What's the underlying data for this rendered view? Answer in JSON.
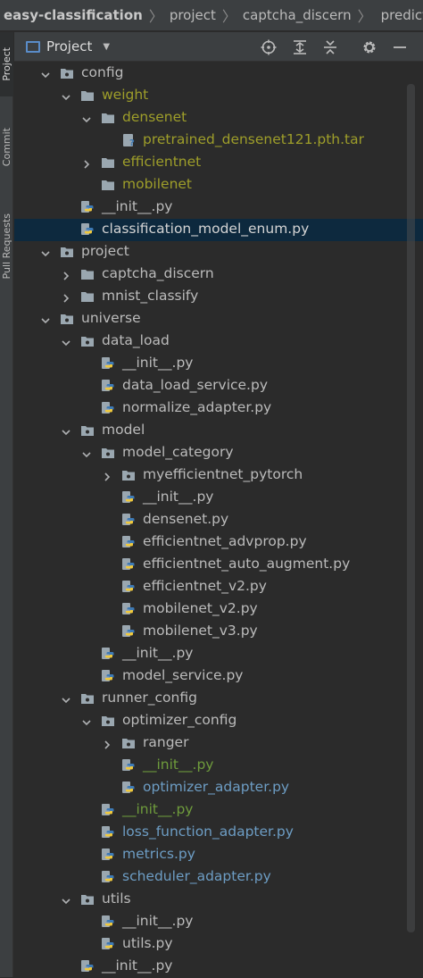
{
  "breadcrumb": {
    "items": [
      "easy-classification",
      "project",
      "captcha_discern",
      "predict.p"
    ]
  },
  "strip": {
    "tabs": [
      "Project",
      "Commit",
      "Pull Requests"
    ]
  },
  "toolbar": {
    "title": "Project"
  },
  "colors": {
    "background": "#2b2b2b",
    "selected_row": "#0d293e",
    "folder": "#9aa7b0",
    "olive_text": "#9e9e2a",
    "green_text": "#6e9b3c",
    "blue_text": "#6d9dc4"
  },
  "tree": [
    {
      "label": "config",
      "depth": 0,
      "kind": "package",
      "chev": "down",
      "color": "normal"
    },
    {
      "label": "weight",
      "depth": 1,
      "kind": "folder",
      "chev": "down",
      "color": "olive"
    },
    {
      "label": "densenet",
      "depth": 2,
      "kind": "folder",
      "chev": "down",
      "color": "olive"
    },
    {
      "label": "pretrained_densenet121.pth.tar",
      "depth": 3,
      "kind": "unknown",
      "chev": "none",
      "color": "olive"
    },
    {
      "label": "efficientnet",
      "depth": 2,
      "kind": "folder",
      "chev": "right",
      "color": "olive"
    },
    {
      "label": "mobilenet",
      "depth": 2,
      "kind": "folder",
      "chev": "none",
      "color": "olive"
    },
    {
      "label": "__init__.py",
      "depth": 1,
      "kind": "python",
      "chev": "none",
      "color": "normal"
    },
    {
      "label": "classification_model_enum.py",
      "depth": 1,
      "kind": "python",
      "chev": "none",
      "color": "white",
      "selected": true
    },
    {
      "label": "project",
      "depth": 0,
      "kind": "package",
      "chev": "down",
      "color": "normal"
    },
    {
      "label": "captcha_discern",
      "depth": 1,
      "kind": "folder",
      "chev": "right",
      "color": "normal"
    },
    {
      "label": "mnist_classify",
      "depth": 1,
      "kind": "folder",
      "chev": "right",
      "color": "normal"
    },
    {
      "label": "universe",
      "depth": 0,
      "kind": "package",
      "chev": "down",
      "color": "normal"
    },
    {
      "label": "data_load",
      "depth": 1,
      "kind": "package",
      "chev": "down",
      "color": "normal"
    },
    {
      "label": "__init__.py",
      "depth": 2,
      "kind": "python",
      "chev": "none",
      "color": "normal"
    },
    {
      "label": "data_load_service.py",
      "depth": 2,
      "kind": "python",
      "chev": "none",
      "color": "normal"
    },
    {
      "label": "normalize_adapter.py",
      "depth": 2,
      "kind": "python",
      "chev": "none",
      "color": "normal"
    },
    {
      "label": "model",
      "depth": 1,
      "kind": "package",
      "chev": "down",
      "color": "normal"
    },
    {
      "label": "model_category",
      "depth": 2,
      "kind": "package",
      "chev": "down",
      "color": "normal"
    },
    {
      "label": "myefficientnet_pytorch",
      "depth": 3,
      "kind": "package",
      "chev": "right",
      "color": "normal"
    },
    {
      "label": "__init__.py",
      "depth": 3,
      "kind": "python",
      "chev": "none",
      "color": "normal"
    },
    {
      "label": "densenet.py",
      "depth": 3,
      "kind": "python",
      "chev": "none",
      "color": "normal"
    },
    {
      "label": "efficientnet_advprop.py",
      "depth": 3,
      "kind": "python",
      "chev": "none",
      "color": "normal"
    },
    {
      "label": "efficientnet_auto_augment.py",
      "depth": 3,
      "kind": "python",
      "chev": "none",
      "color": "normal"
    },
    {
      "label": "efficientnet_v2.py",
      "depth": 3,
      "kind": "python",
      "chev": "none",
      "color": "normal"
    },
    {
      "label": "mobilenet_v2.py",
      "depth": 3,
      "kind": "python",
      "chev": "none",
      "color": "normal"
    },
    {
      "label": "mobilenet_v3.py",
      "depth": 3,
      "kind": "python",
      "chev": "none",
      "color": "normal"
    },
    {
      "label": "__init__.py",
      "depth": 2,
      "kind": "python",
      "chev": "none",
      "color": "normal"
    },
    {
      "label": "model_service.py",
      "depth": 2,
      "kind": "python",
      "chev": "none",
      "color": "normal"
    },
    {
      "label": "runner_config",
      "depth": 1,
      "kind": "package",
      "chev": "down",
      "color": "normal"
    },
    {
      "label": "optimizer_config",
      "depth": 2,
      "kind": "package",
      "chev": "down",
      "color": "normal"
    },
    {
      "label": "ranger",
      "depth": 3,
      "kind": "package",
      "chev": "right",
      "color": "normal"
    },
    {
      "label": "__init__.py",
      "depth": 3,
      "kind": "python",
      "chev": "none",
      "color": "green"
    },
    {
      "label": "optimizer_adapter.py",
      "depth": 3,
      "kind": "python",
      "chev": "none",
      "color": "blue"
    },
    {
      "label": "__init__.py",
      "depth": 2,
      "kind": "python",
      "chev": "none",
      "color": "green"
    },
    {
      "label": "loss_function_adapter.py",
      "depth": 2,
      "kind": "python",
      "chev": "none",
      "color": "blue"
    },
    {
      "label": "metrics.py",
      "depth": 2,
      "kind": "python",
      "chev": "none",
      "color": "blue"
    },
    {
      "label": "scheduler_adapter.py",
      "depth": 2,
      "kind": "python",
      "chev": "none",
      "color": "blue"
    },
    {
      "label": "utils",
      "depth": 1,
      "kind": "package",
      "chev": "down",
      "color": "normal"
    },
    {
      "label": "__init__.py",
      "depth": 2,
      "kind": "python",
      "chev": "none",
      "color": "normal"
    },
    {
      "label": "utils.py",
      "depth": 2,
      "kind": "python",
      "chev": "none",
      "color": "normal"
    },
    {
      "label": "__init__.py",
      "depth": 1,
      "kind": "python",
      "chev": "none",
      "color": "normal"
    }
  ]
}
